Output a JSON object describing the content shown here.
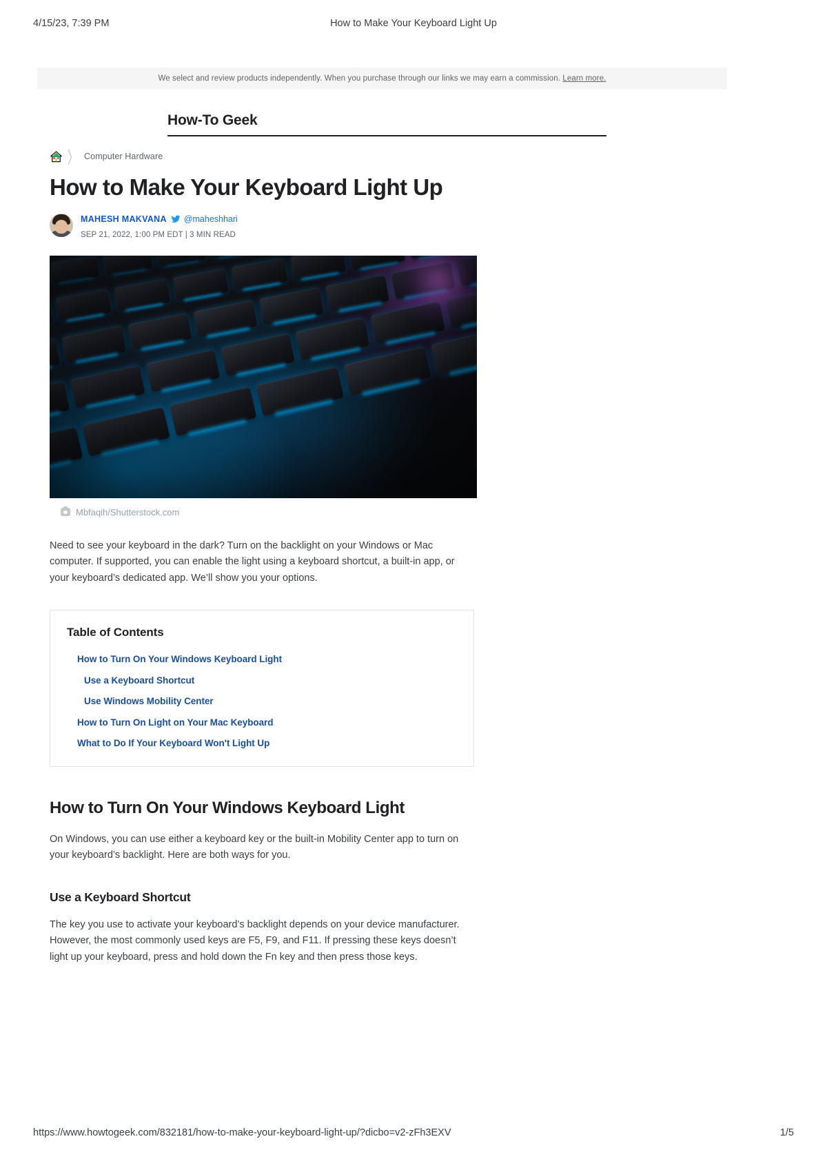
{
  "print_header": {
    "timestamp": "4/15/23, 7:39 PM",
    "document_title": "How to Make Your Keyboard Light Up"
  },
  "print_footer": {
    "url": "https://www.howtogeek.com/832181/how-to-make-your-keyboard-light-up/?dicbo=v2-zFh3EXV",
    "page": "1/5"
  },
  "disclosure": {
    "text": "We select and review products independently. When you purchase through our links we may earn a commission.",
    "link_label": "Learn more."
  },
  "masthead": {
    "logo": "How-To Geek"
  },
  "breadcrumb": {
    "home_icon": "home-icon",
    "separator": "〉",
    "category": "Computer Hardware"
  },
  "article": {
    "title": "How to Make Your Keyboard Light Up",
    "byline": {
      "author": "MAHESH MAKVANA",
      "twitter_icon": "twitter-bird-icon",
      "handle": "@maheshhari",
      "meta": "SEP 21, 2022, 1:00 PM EDT | 3 MIN READ"
    },
    "hero": {
      "alt": "Backlit laptop keyboard glowing blue in the dark",
      "caption_icon": "camera-icon",
      "caption": "Mbfaqih/Shutterstock.com"
    },
    "lede": "Need to see your keyboard in the dark? Turn on the backlight on your Windows or Mac computer. If supported, you can enable the light using a keyboard shortcut, a built-in app, or your keyboard’s dedicated app. We’ll show you your options.",
    "toc": {
      "title": "Table of Contents",
      "items": [
        {
          "label": "How to Turn On Your Windows Keyboard Light",
          "level": 1
        },
        {
          "label": "Use a Keyboard Shortcut",
          "level": 2
        },
        {
          "label": "Use Windows Mobility Center",
          "level": 2
        },
        {
          "label": "How to Turn On Light on Your Mac Keyboard",
          "level": 1
        },
        {
          "label": "What to Do If Your Keyboard Won't Light Up",
          "level": 1
        }
      ]
    },
    "sections": [
      {
        "heading": "How to Turn On Your Windows Keyboard Light",
        "paragraph": "On Windows, you can use either a keyboard key or the built-in Mobility Center app to turn on your keyboard’s backlight. Here are both ways for you."
      },
      {
        "subheading": "Use a Keyboard Shortcut",
        "paragraph": "The key you use to activate your keyboard’s backlight depends on your device manufacturer. However, the most commonly used keys are F5, F9, and F11. If pressing these keys doesn’t light up your keyboard, press and hold down the Fn key and then press those keys."
      }
    ]
  },
  "colors": {
    "link_blue": "#1a4f9c",
    "author_blue": "#1155cc",
    "handle_blue": "#1a73e8",
    "text_primary": "#202124",
    "text_body": "#3c4043",
    "text_muted": "#5f6368",
    "caption_gray": "#9aa0a6",
    "strip_bg": "#f5f5f5"
  }
}
